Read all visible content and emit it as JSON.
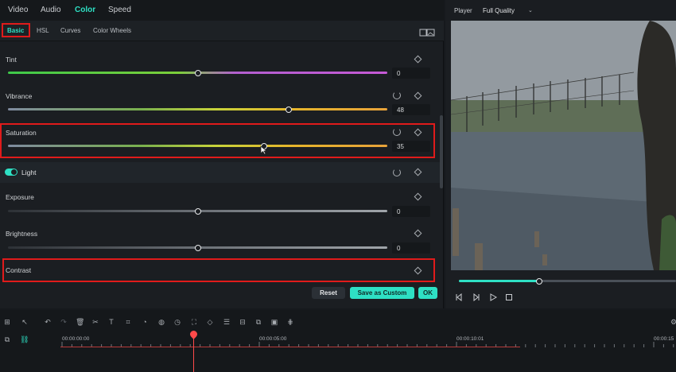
{
  "tabs": [
    "Video",
    "Audio",
    "Color",
    "Speed"
  ],
  "active_tab": "Color",
  "sub_tabs": [
    "Basic",
    "HSL",
    "Curves",
    "Color Wheels"
  ],
  "active_sub_tab": "Basic",
  "rows": {
    "tint": {
      "label": "Tint",
      "value": "0",
      "level": 0.5
    },
    "vibrance": {
      "label": "Vibrance",
      "value": "48",
      "level": 0.74
    },
    "saturation": {
      "label": "Saturation",
      "value": "35",
      "level": 0.675
    },
    "exposure": {
      "label": "Exposure",
      "value": "0",
      "level": 0.5
    },
    "brightness": {
      "label": "Brightness",
      "value": "0",
      "level": 0.5
    },
    "contrast": {
      "label": "Contrast"
    }
  },
  "light_section": {
    "label": "Light",
    "enabled": true
  },
  "buttons": {
    "reset": "Reset",
    "save": "Save as Custom",
    "ok": "OK"
  },
  "player": {
    "label": "Player",
    "quality": "Full Quality",
    "progress": 0.37
  },
  "timeline": {
    "times": [
      "00:00:00:00",
      "00:00:05:00",
      "00:00:10:01",
      "00:00:15"
    ]
  },
  "colors": {
    "accent": "#2ee0c4",
    "highlight": "#e01b1b",
    "playhead": "#ff4a4a"
  }
}
